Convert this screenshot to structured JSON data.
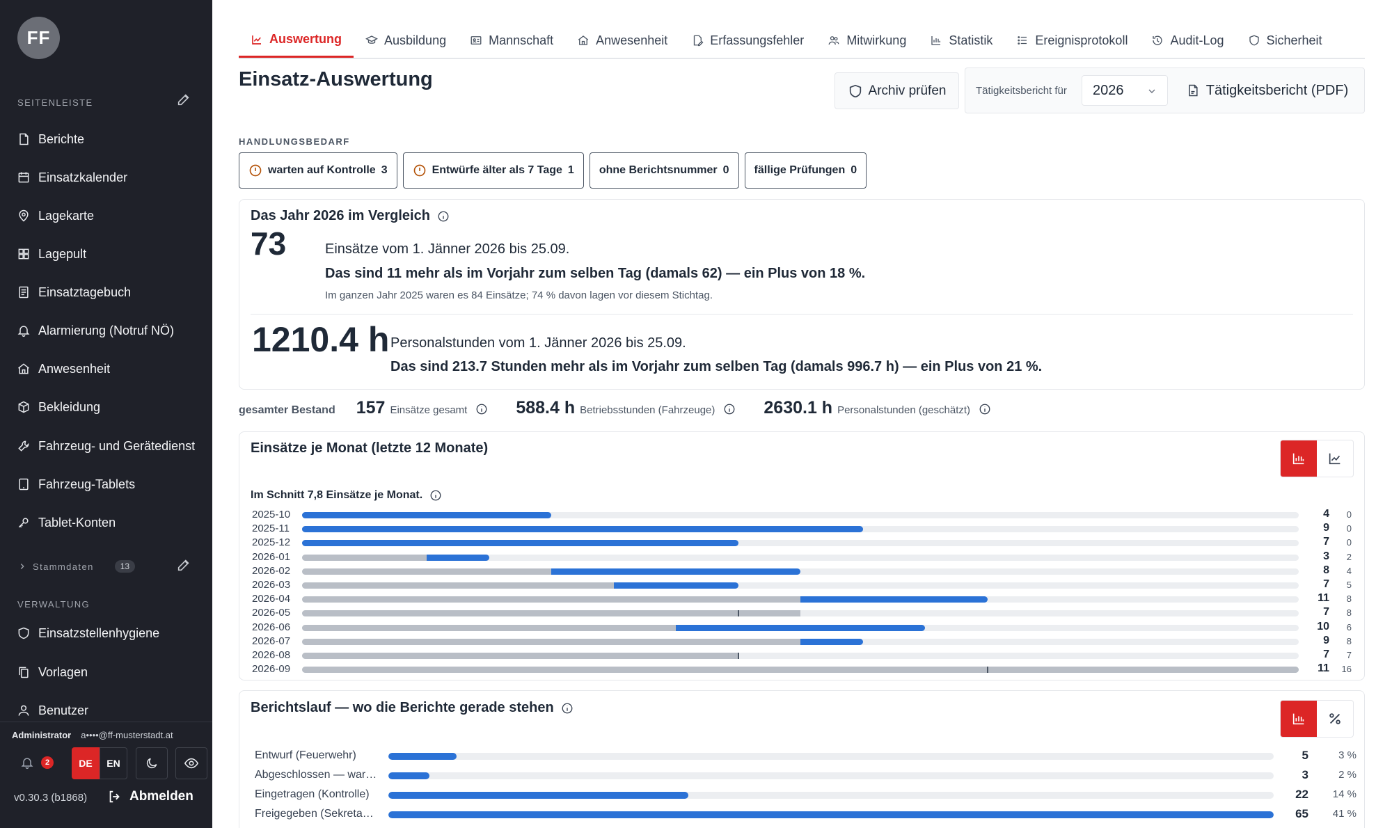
{
  "sidebar": {
    "logo": "FF",
    "section_label": "Seitenleiste",
    "items": [
      {
        "label": "Berichte",
        "icon": "document-icon"
      },
      {
        "label": "Einsatzkalender",
        "icon": "calendar-icon"
      },
      {
        "label": "Lagekarte",
        "icon": "map-pin-icon"
      },
      {
        "label": "Lagepult",
        "icon": "grid-icon"
      },
      {
        "label": "Einsatztagebuch",
        "icon": "journal-icon"
      },
      {
        "label": "Alarmierung (Notruf NÖ)",
        "icon": "bell-icon"
      },
      {
        "label": "Anwesenheit",
        "icon": "home-icon"
      },
      {
        "label": "Bekleidung",
        "icon": "box-icon"
      },
      {
        "label": "Fahrzeug- und Gerätedienst",
        "icon": "wrench-icon"
      },
      {
        "label": "Fahrzeug-Tablets",
        "icon": "tablet-icon"
      },
      {
        "label": "Tablet-Konten",
        "icon": "key-icon"
      }
    ],
    "stammdaten_label": "Stammdaten",
    "stammdaten_count": "13",
    "verwaltung_label": "Verwaltung",
    "verwaltung_items": [
      {
        "label": "Einsatzstellenhygiene",
        "icon": "shield-icon"
      },
      {
        "label": "Vorlagen",
        "icon": "copy-icon"
      },
      {
        "label": "Benutzer",
        "icon": "user-icon"
      }
    ],
    "user_role": "Administrator",
    "user_mail": "a••••@ff-musterstadt.at",
    "notifications": "2",
    "lang_de": "DE",
    "lang_en": "EN",
    "version": "v0.30.3 (b1868)",
    "logout": "Abmelden"
  },
  "tabs": [
    {
      "label": "Auswertung",
      "active": true
    },
    {
      "label": "Ausbildung"
    },
    {
      "label": "Mannschaft"
    },
    {
      "label": "Anwesenheit"
    },
    {
      "label": "Erfassungsfehler"
    },
    {
      "label": "Mitwirkung"
    },
    {
      "label": "Statistik"
    },
    {
      "label": "Ereignisprotokoll"
    },
    {
      "label": "Audit-Log"
    },
    {
      "label": "Sicherheit"
    }
  ],
  "header": {
    "title": "Einsatz-Auswertung",
    "archive_button": "Archiv prüfen",
    "report_label": "Tätigkeitsbericht für",
    "report_year": "2026",
    "pdf_button": "Tätigkeitsbericht (PDF)"
  },
  "action": {
    "title": "Handlungsbedarf",
    "chips": [
      {
        "label": "warten auf Kontrolle",
        "count": "3",
        "warn": true
      },
      {
        "label": "Entwürfe älter als 7 Tage",
        "count": "1",
        "warn": true
      },
      {
        "label": "ohne Berichtsnummer",
        "count": "0",
        "warn": false
      },
      {
        "label": "fällige Prüfungen",
        "count": "0",
        "warn": false
      }
    ]
  },
  "compare": {
    "title": "Das Jahr 2026 im Vergleich",
    "count": "73",
    "count_text": "Einsätze vom 1. Jänner 2026 bis 25.09.",
    "count_bold": "Das sind 11 mehr als im Vorjahr zum selben Tag (damals 62) — ein Plus von 18 %.",
    "count_small": "Im ganzen Jahr 2025 waren es 84 Einsätze; 74 % davon lagen vor diesem Stichtag.",
    "hours": "1210.4 h",
    "hours_text": "Personalstunden vom 1. Jänner 2026 bis 25.09.",
    "hours_bold": "Das sind 213.7 Stunden mehr als im Vorjahr zum selben Tag (damals 996.7 h) — ein Plus von 21 %."
  },
  "stock": {
    "label": "gesamter Bestand",
    "items": [
      {
        "value": "157",
        "unit": "Einsätze gesamt"
      },
      {
        "value": "588.4 h",
        "unit": "Betriebsstunden (Fahrzeuge)"
      },
      {
        "value": "2630.1 h",
        "unit": "Personalstunden (geschätzt)"
      }
    ]
  },
  "monthly": {
    "title": "Einsätze je Monat (letzte 12 Monate)",
    "avg": "Im Schnitt 7,8 Einsätze je Monat."
  },
  "chart_data": [
    {
      "type": "bar",
      "title": "Einsätze je Monat (letzte 12 Monate)",
      "categories": [
        "2025-10",
        "2025-11",
        "2025-12",
        "2026-01",
        "2026-02",
        "2026-03",
        "2026-04",
        "2026-05",
        "2026-06",
        "2026-07",
        "2026-08",
        "2026-09"
      ],
      "series": [
        {
          "values": [
            4,
            9,
            7,
            3,
            8,
            7,
            11,
            7,
            10,
            9,
            7,
            11
          ]
        },
        {
          "values": [
            0,
            0,
            0,
            2,
            4,
            5,
            8,
            8,
            6,
            8,
            7,
            16
          ]
        }
      ],
      "xlim": [
        0,
        16
      ]
    },
    {
      "type": "bar",
      "title": "Berichtslauf — wo die Berichte gerade stehen",
      "categories": [
        "Entwurf (Feuerwehr)",
        "Abgeschlossen — war…",
        "Eingetragen (Kontrolle)",
        "Freigegeben (Sekreta…"
      ],
      "values": [
        5,
        3,
        22,
        65
      ],
      "percent": [
        "3 %",
        "2 %",
        "14 %",
        "41 %"
      ],
      "xlim": [
        0,
        65
      ]
    }
  ],
  "status": {
    "title": "Berichtslauf — wo die Berichte gerade stehen"
  },
  "colors": {
    "accent": "#dc2626",
    "bar_current": "#2b72d6",
    "bar_previous": "#b9bec6",
    "sidebar_bg": "#1f2129"
  }
}
